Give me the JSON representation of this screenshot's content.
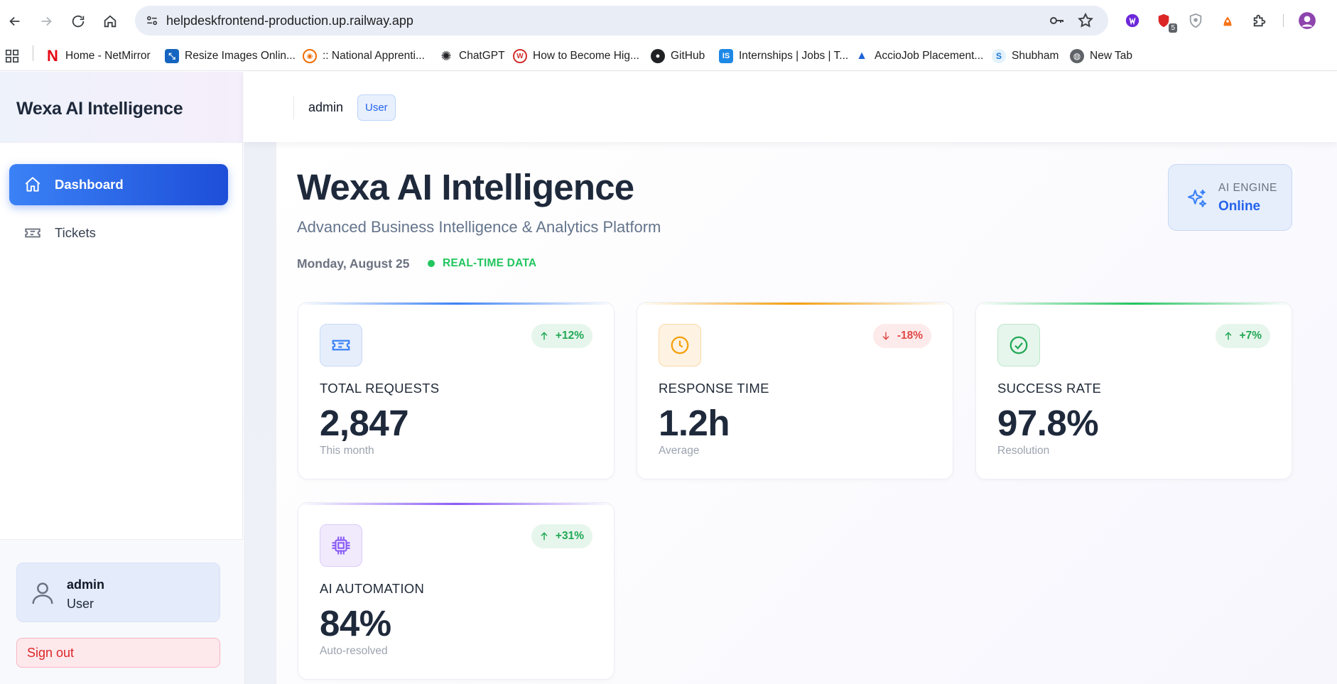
{
  "browser": {
    "url": "helpdeskfrontend-production.up.railway.app",
    "extension_badge": "5",
    "bookmarks": [
      {
        "label": "Home - NetMirror",
        "icon": "netmirror-icon",
        "color": "#e50914"
      },
      {
        "label": "Resize Images Onlin...",
        "icon": "resize-images-icon",
        "color": "#1565c0"
      },
      {
        "label": ":: National Apprenti...",
        "icon": "apprenticeship-icon",
        "color": "#ef6c00"
      },
      {
        "label": "ChatGPT",
        "icon": "chatgpt-icon",
        "color": "#202124"
      },
      {
        "label": "How to Become Hig...",
        "icon": "article-icon",
        "color": "#d32f2f"
      },
      {
        "label": "GitHub",
        "icon": "github-icon",
        "color": "#202124"
      },
      {
        "label": "Internships | Jobs | T...",
        "icon": "internshala-icon",
        "color": "#1e88e5"
      },
      {
        "label": "AccioJob Placement...",
        "icon": "acciojob-icon",
        "color": "#1e63d6"
      },
      {
        "label": "Shubham",
        "icon": "shubham-icon",
        "color": "#1976d2"
      },
      {
        "label": "New Tab",
        "icon": "globe-icon",
        "color": "#5f6368"
      }
    ]
  },
  "sidebar": {
    "brand": "Wexa AI Intelligence",
    "items": [
      {
        "label": "Dashboard",
        "icon": "home-icon",
        "active": true
      },
      {
        "label": "Tickets",
        "icon": "ticket-icon",
        "active": false
      }
    ],
    "user": {
      "name": "admin",
      "role": "User"
    },
    "signout_label": "Sign out"
  },
  "topbar": {
    "username": "admin",
    "role_badge": "User"
  },
  "hero": {
    "title": "Wexa AI Intelligence",
    "subtitle": "Advanced Business Intelligence & Analytics Platform",
    "date": "Monday, August 25",
    "live_label": "REAL-TIME DATA",
    "engine_label": "AI ENGINE",
    "engine_status": "Online"
  },
  "stats": [
    {
      "label": "TOTAL REQUESTS",
      "value": "2,847",
      "sub": "This month",
      "trend": "+12%",
      "direction": "up",
      "icon": "ticket-icon",
      "accent": "#3b82f6"
    },
    {
      "label": "RESPONSE TIME",
      "value": "1.2h",
      "sub": "Average",
      "trend": "-18%",
      "direction": "down",
      "icon": "clock-icon",
      "accent": "#f59e0b"
    },
    {
      "label": "SUCCESS RATE",
      "value": "97.8%",
      "sub": "Resolution",
      "trend": "+7%",
      "direction": "up",
      "icon": "check-circle-icon",
      "accent": "#22c55e"
    },
    {
      "label": "AI AUTOMATION",
      "value": "84%",
      "sub": "Auto-resolved",
      "trend": "+31%",
      "direction": "up",
      "icon": "cpu-icon",
      "accent": "#8b5cf6"
    }
  ]
}
